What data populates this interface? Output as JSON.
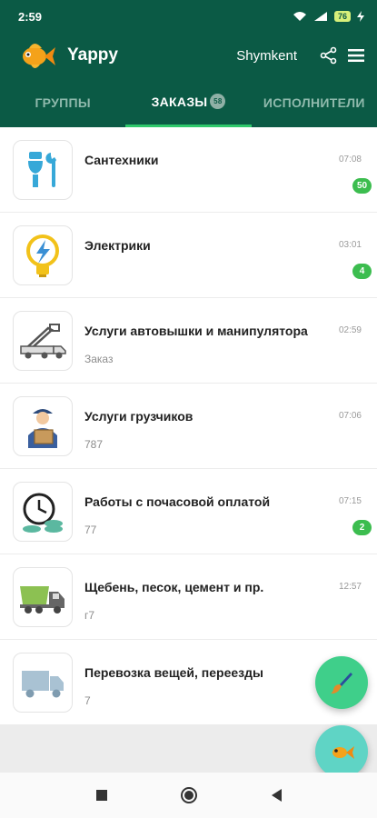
{
  "status_bar": {
    "time": "2:59",
    "battery": "76"
  },
  "app": {
    "title": "Yappy",
    "city": "Shymkent"
  },
  "tabs": [
    {
      "label": "ГРУППЫ"
    },
    {
      "label": "ЗАКАЗЫ",
      "badge": "58"
    },
    {
      "label": "ИСПОЛНИТЕЛИ"
    }
  ],
  "items": [
    {
      "title": "Сантехники",
      "subtitle": "",
      "time": "07:08",
      "count": "50",
      "icon": "plumbing-icon"
    },
    {
      "title": "Электрики",
      "subtitle": "",
      "time": "03:01",
      "count": "4",
      "icon": "lightbulb-icon"
    },
    {
      "title": "Услуги автовышки и манипулятора",
      "subtitle": "Заказ",
      "time": "02:59",
      "count": "",
      "icon": "crane-truck-icon"
    },
    {
      "title": "Услуги грузчиков",
      "subtitle": "787",
      "time": "07:06",
      "count": "",
      "icon": "mover-icon"
    },
    {
      "title": "Работы с почасовой оплатой",
      "subtitle": "77",
      "time": "07:15",
      "count": "2",
      "icon": "clock-money-icon"
    },
    {
      "title": "Щебень, песок, цемент и пр.",
      "subtitle": "г7",
      "time": "12:57",
      "count": "",
      "icon": "dump-truck-icon"
    },
    {
      "title": "Перевозка вещей, переезды",
      "subtitle": "7",
      "time": "",
      "count": "",
      "icon": "delivery-truck-icon"
    }
  ],
  "colors": {
    "primary": "#0b5a45",
    "accent": "#2fc86b",
    "badge": "#3cbd4f"
  }
}
